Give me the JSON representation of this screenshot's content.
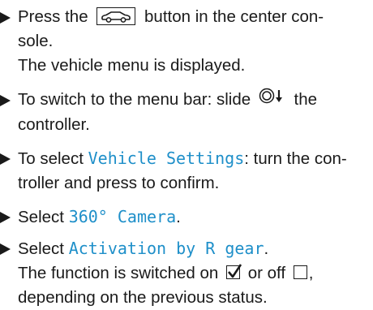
{
  "steps": [
    {
      "before": "Press the",
      "icon": "car-icon-button",
      "after": "button in the center con-",
      "line2": "sole.",
      "result": "The vehicle menu is displayed."
    },
    {
      "before": "To switch to the menu bar: slide",
      "icon": "controller-slide-down-icon",
      "after": "the",
      "line2": "controller."
    },
    {
      "before": "To select",
      "highlight": "Vehicle Settings",
      "after": ": turn the con-",
      "line2": "troller and press to confirm."
    },
    {
      "before": "Select",
      "highlight": "360° Camera",
      "after": "."
    },
    {
      "before": "Select",
      "highlight": "Activation by R gear",
      "after": ".",
      "result_1": "The function is switched on",
      "result_mid": "or off",
      "result_end": ",",
      "result_2": "depending on the previous status.",
      "icons": [
        "checked-box-icon",
        "empty-box-icon"
      ]
    }
  ],
  "colors": {
    "highlight": "#1e8fc9",
    "text": "#1a1a1a"
  }
}
